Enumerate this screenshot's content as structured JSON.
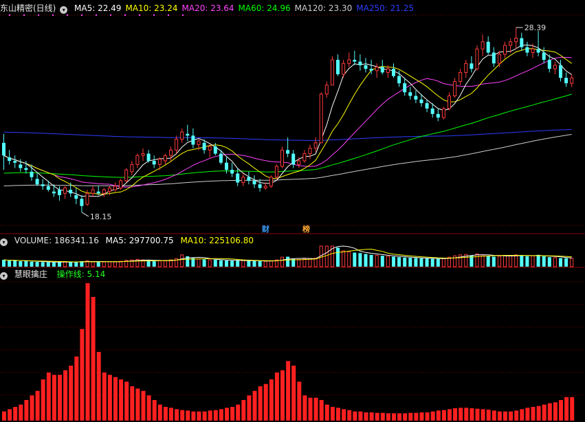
{
  "price_panel": {
    "title": "东山精密(日线)",
    "ma_items": [
      {
        "label": "MA5: 22.49",
        "color": "#ffffff"
      },
      {
        "label": "MA10: 23.24",
        "color": "#ffff00"
      },
      {
        "label": "MA20: 23.64",
        "color": "#ff44ff"
      },
      {
        "label": "MA60: 24.96",
        "color": "#00ff00"
      },
      {
        "label": "MA120: 23.30",
        "color": "#cccccc"
      },
      {
        "label": "MA250: 21.25",
        "color": "#2e3cff"
      }
    ],
    "high_label": "28.39",
    "low_label": "18.15",
    "marker_cai": "财",
    "marker_bang": "榜"
  },
  "volume_panel": {
    "label_volume": "VOLUME: 186341.16",
    "label_ma5": "MA5: 297700.75",
    "label_ma10": "MA10: 225106.80"
  },
  "indicator_panel": {
    "title": "慧眼擒庄",
    "line_label": "操作线: 5.14"
  },
  "colors": {
    "up": "#ff3b3b",
    "down": "#54ffff",
    "ma5": "#ffffff",
    "ma10": "#ffff00",
    "ma20": "#ff44ff",
    "ma60": "#00ff00",
    "ma120": "#cccccc",
    "ma250": "#2e3cff",
    "grid": "#8a0000",
    "indicator_bar": "#ff2020"
  },
  "chart_data": [
    {
      "type": "candlestick",
      "title": "东山精密(日线)",
      "y_range": [
        17.5,
        29.0
      ],
      "candles": [
        [
          22.0,
          22.5,
          20.5,
          21.3
        ],
        [
          21.2,
          21.6,
          20.8,
          21.0
        ],
        [
          21.0,
          21.3,
          20.6,
          20.9
        ],
        [
          20.8,
          21.1,
          20.4,
          20.6
        ],
        [
          20.6,
          21.0,
          20.3,
          20.5
        ],
        [
          20.4,
          20.8,
          19.9,
          20.1
        ],
        [
          20.0,
          20.3,
          19.6,
          19.7
        ],
        [
          19.7,
          20.0,
          19.4,
          19.6
        ],
        [
          19.6,
          19.9,
          19.3,
          19.4
        ],
        [
          19.3,
          19.7,
          19.0,
          19.2
        ],
        [
          19.4,
          19.6,
          18.8,
          19.1
        ],
        [
          19.2,
          19.6,
          18.9,
          19.5
        ],
        [
          19.4,
          19.8,
          19.0,
          19.2
        ],
        [
          19.1,
          19.5,
          18.6,
          18.9
        ],
        [
          18.9,
          19.1,
          18.15,
          18.5
        ],
        [
          18.6,
          19.4,
          18.5,
          19.2
        ],
        [
          19.2,
          19.6,
          19.0,
          19.4
        ],
        [
          19.3,
          19.6,
          19.1,
          19.2
        ],
        [
          19.2,
          19.5,
          19.0,
          19.4
        ],
        [
          19.3,
          19.6,
          19.1,
          19.5
        ],
        [
          19.4,
          19.8,
          19.3,
          19.6
        ],
        [
          19.5,
          20.0,
          19.4,
          19.9
        ],
        [
          19.9,
          20.6,
          19.8,
          20.5
        ],
        [
          20.4,
          21.0,
          20.2,
          20.8
        ],
        [
          20.8,
          21.4,
          20.6,
          21.3
        ],
        [
          21.3,
          21.7,
          21.0,
          21.4
        ],
        [
          21.4,
          21.6,
          20.9,
          21.0
        ],
        [
          21.0,
          21.3,
          20.6,
          20.8
        ],
        [
          20.8,
          21.2,
          20.5,
          21.1
        ],
        [
          21.0,
          21.4,
          20.8,
          21.3
        ],
        [
          21.3,
          21.8,
          21.0,
          21.6
        ],
        [
          21.6,
          22.4,
          21.4,
          22.2
        ],
        [
          22.2,
          22.8,
          22.0,
          22.6
        ],
        [
          22.5,
          23.0,
          22.1,
          22.4
        ],
        [
          22.4,
          22.8,
          21.7,
          21.9
        ],
        [
          21.9,
          22.2,
          21.6,
          22.1
        ],
        [
          22.0,
          22.2,
          21.4,
          21.6
        ],
        [
          21.6,
          21.9,
          21.2,
          21.8
        ],
        [
          21.8,
          22.0,
          21.3,
          21.4
        ],
        [
          21.4,
          21.6,
          20.8,
          20.9
        ],
        [
          20.9,
          21.2,
          20.3,
          20.5
        ],
        [
          20.5,
          20.9,
          20.1,
          20.3
        ],
        [
          20.3,
          20.6,
          19.6,
          19.8
        ],
        [
          19.8,
          20.3,
          19.6,
          20.1
        ],
        [
          20.1,
          20.4,
          19.7,
          19.9
        ],
        [
          19.9,
          20.2,
          19.5,
          19.7
        ],
        [
          19.7,
          20.0,
          19.3,
          19.5
        ],
        [
          19.5,
          19.8,
          19.4,
          19.6
        ],
        [
          19.6,
          20.2,
          19.5,
          20.1
        ],
        [
          20.1,
          20.8,
          20.0,
          20.7
        ],
        [
          20.7,
          21.8,
          20.6,
          21.6
        ],
        [
          21.6,
          22.3,
          21.2,
          21.4
        ],
        [
          21.4,
          21.6,
          20.6,
          20.8
        ],
        [
          20.8,
          21.2,
          20.6,
          21.0
        ],
        [
          21.0,
          21.6,
          20.9,
          21.4
        ],
        [
          21.4,
          21.9,
          21.1,
          21.7
        ],
        [
          21.7,
          22.3,
          21.5,
          22.0
        ],
        [
          22.0,
          24.8,
          22.0,
          24.7
        ],
        [
          24.7,
          25.4,
          24.5,
          25.2
        ],
        [
          25.2,
          26.8,
          25.2,
          26.6
        ],
        [
          26.6,
          26.9,
          25.7,
          25.8
        ],
        [
          25.8,
          26.6,
          25.6,
          26.4
        ],
        [
          26.4,
          27.0,
          26.2,
          26.6
        ],
        [
          26.6,
          27.1,
          26.3,
          26.5
        ],
        [
          26.5,
          26.9,
          26.0,
          26.3
        ],
        [
          26.3,
          26.7,
          25.9,
          26.1
        ],
        [
          26.1,
          26.6,
          25.8,
          26.0
        ],
        [
          26.0,
          26.4,
          25.6,
          26.2
        ],
        [
          26.2,
          26.6,
          25.8,
          25.9
        ],
        [
          25.9,
          26.3,
          25.6,
          26.1
        ],
        [
          26.1,
          26.4,
          25.6,
          25.7
        ],
        [
          25.7,
          26.0,
          25.1,
          25.3
        ],
        [
          25.3,
          25.6,
          24.6,
          24.8
        ],
        [
          24.8,
          25.1,
          24.4,
          24.6
        ],
        [
          24.6,
          24.9,
          24.2,
          24.4
        ],
        [
          24.4,
          24.7,
          24.0,
          24.2
        ],
        [
          24.2,
          24.4,
          23.7,
          23.9
        ],
        [
          23.9,
          24.2,
          23.4,
          23.6
        ],
        [
          23.6,
          23.9,
          23.2,
          23.4
        ],
        [
          23.4,
          24.0,
          23.3,
          23.9
        ],
        [
          23.9,
          24.8,
          23.8,
          24.6
        ],
        [
          24.6,
          25.6,
          24.5,
          25.4
        ],
        [
          25.4,
          26.1,
          25.2,
          25.9
        ],
        [
          25.9,
          26.6,
          25.6,
          26.4
        ],
        [
          26.4,
          26.8,
          25.9,
          26.1
        ],
        [
          26.1,
          27.4,
          26.0,
          27.2
        ],
        [
          27.2,
          28.0,
          26.8,
          27.6
        ],
        [
          27.6,
          27.9,
          26.9,
          27.0
        ],
        [
          27.0,
          27.3,
          26.2,
          26.4
        ],
        [
          26.4,
          27.1,
          26.2,
          26.9
        ],
        [
          26.9,
          27.6,
          26.7,
          27.4
        ],
        [
          27.4,
          27.8,
          27.0,
          27.6
        ],
        [
          27.6,
          28.39,
          27.2,
          27.8
        ],
        [
          27.8,
          28.1,
          27.1,
          27.3
        ],
        [
          27.3,
          27.6,
          26.8,
          27.0
        ],
        [
          27.0,
          27.5,
          26.7,
          27.2
        ],
        [
          27.2,
          28.2,
          26.8,
          27.0
        ],
        [
          27.0,
          27.3,
          26.4,
          26.6
        ],
        [
          26.6,
          26.9,
          25.9,
          26.1
        ],
        [
          26.1,
          26.5,
          25.8,
          26.3
        ],
        [
          26.3,
          26.6,
          25.4,
          25.6
        ],
        [
          25.6,
          25.9,
          25.1,
          25.3
        ],
        [
          25.3,
          25.8,
          25.1,
          25.6
        ]
      ]
    },
    {
      "type": "bar",
      "title": "VOLUME",
      "series_name": "VOLUME",
      "y_range": [
        0,
        1000000
      ],
      "values": [
        150000,
        130000,
        140000,
        120000,
        125000,
        110000,
        105000,
        100000,
        98000,
        95000,
        110000,
        115000,
        100000,
        105000,
        120000,
        130000,
        110000,
        100000,
        105000,
        110000,
        115000,
        120000,
        140000,
        150000,
        160000,
        150000,
        130000,
        120000,
        130000,
        140000,
        150000,
        180000,
        260000,
        230000,
        190000,
        170000,
        160000,
        150000,
        150000,
        140000,
        135000,
        130000,
        140000,
        135000,
        130000,
        125000,
        120000,
        118000,
        130000,
        150000,
        210000,
        220000,
        170000,
        160000,
        170000,
        180000,
        190000,
        520000,
        480000,
        620000,
        420000,
        350000,
        330000,
        310000,
        300000,
        280000,
        260000,
        250000,
        240000,
        230000,
        220000,
        210000,
        200000,
        195000,
        190000,
        185000,
        180000,
        175000,
        170000,
        180000,
        210000,
        240000,
        260000,
        270000,
        250000,
        280000,
        260000,
        240000,
        220000,
        230000,
        250000,
        240000,
        260000,
        250000,
        230000,
        240000,
        260000,
        230000,
        210000,
        200000,
        190000,
        186341.16,
        186341.16
      ]
    },
    {
      "type": "bar",
      "title": "慧眼擒庄",
      "series_name": "操作线",
      "y_range": [
        0,
        30
      ],
      "values": [
        2.0,
        2.5,
        3.0,
        3.5,
        4.5,
        5.5,
        6.5,
        9.0,
        10.5,
        10.0,
        10.0,
        11.0,
        12.0,
        14.0,
        20.0,
        30.0,
        27.0,
        15.0,
        10.5,
        10.0,
        9.5,
        9.0,
        8.5,
        7.5,
        7.0,
        6.5,
        5.5,
        4.5,
        3.5,
        3.0,
        2.8,
        2.5,
        2.3,
        2.2,
        2.0,
        2.0,
        2.0,
        2.2,
        2.3,
        2.5,
        2.8,
        3.0,
        3.5,
        4.5,
        5.5,
        6.5,
        7.5,
        8.0,
        9.0,
        10.5,
        11.0,
        13.0,
        12.0,
        8.5,
        5.5,
        5.0,
        5.0,
        4.5,
        3.5,
        3.0,
        2.8,
        2.5,
        2.3,
        2.0,
        2.0,
        1.8,
        1.8,
        1.7,
        1.7,
        1.6,
        1.6,
        1.6,
        1.6,
        1.7,
        1.7,
        1.8,
        1.8,
        2.0,
        2.2,
        2.3,
        2.5,
        2.7,
        2.8,
        2.8,
        2.7,
        2.6,
        2.5,
        2.4,
        2.2,
        2.0,
        2.0,
        2.0,
        2.2,
        2.5,
        2.8,
        3.0,
        3.2,
        3.5,
        3.8,
        4.0,
        4.5,
        5.14,
        5.14
      ]
    }
  ]
}
